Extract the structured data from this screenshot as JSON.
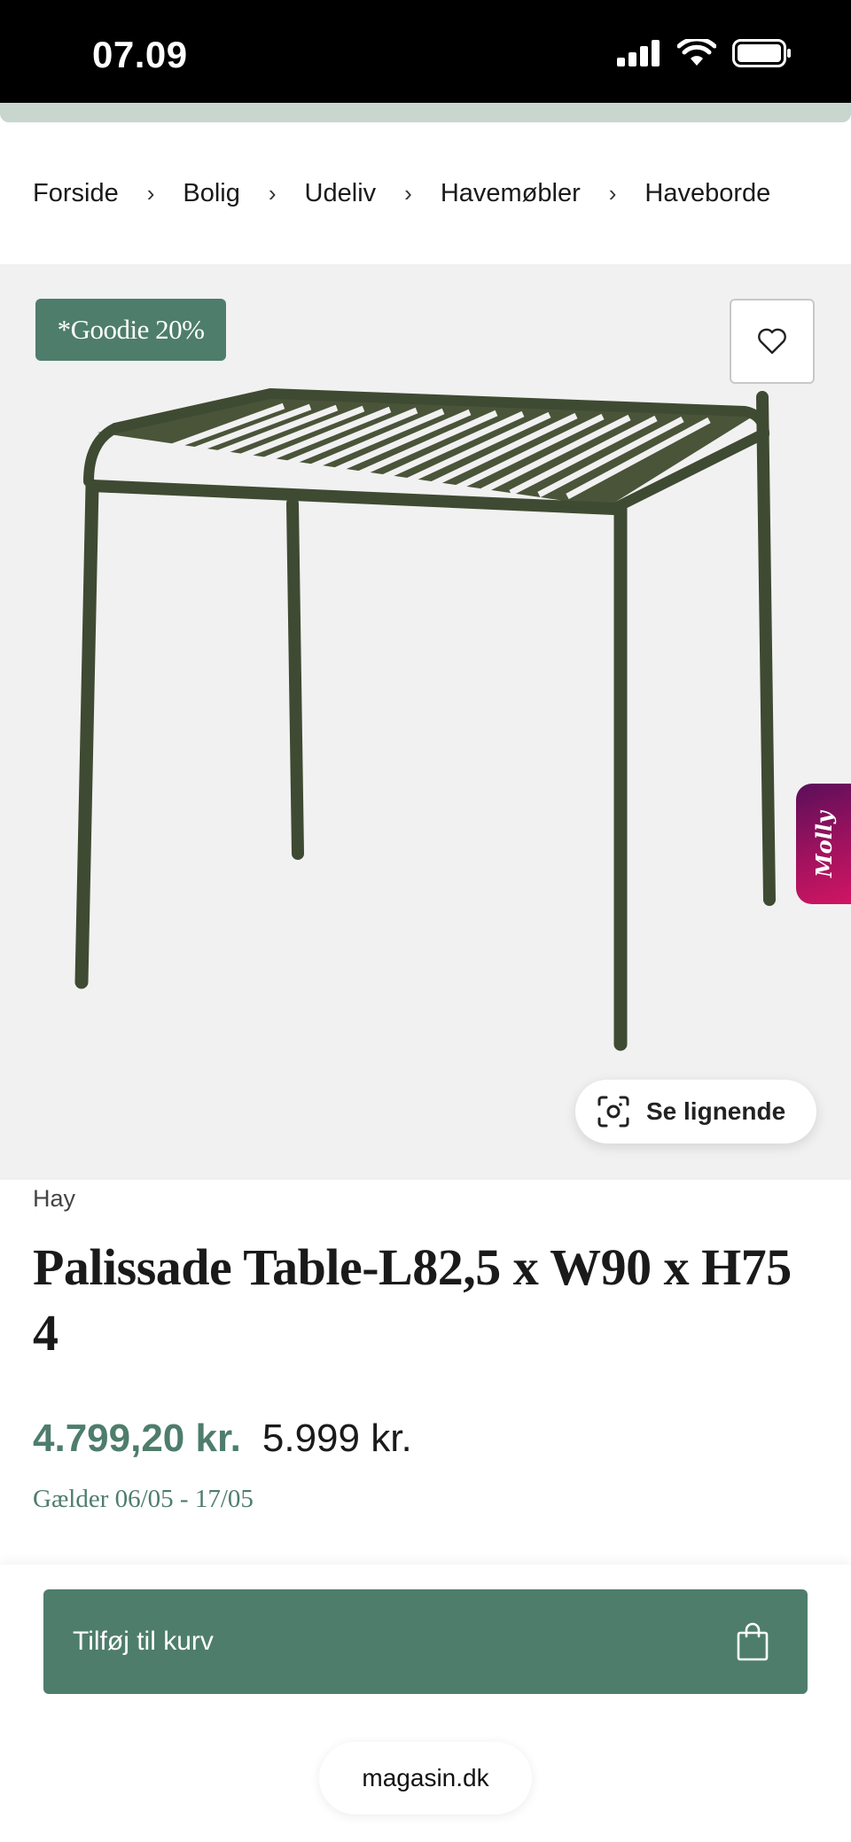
{
  "status_bar": {
    "time": "07.09",
    "icons": [
      "signal-icon",
      "wifi-icon",
      "battery-icon"
    ]
  },
  "breadcrumb": {
    "items": [
      "Forside",
      "Bolig",
      "Udeliv",
      "Havemøbler",
      "Haveborde"
    ],
    "separator": "›"
  },
  "product_image": {
    "badge": "*Goodie 20%",
    "favorite_icon": "heart-icon",
    "side_tab": "Molly",
    "similar_label": "Se lignende",
    "similar_icon": "visual-search-icon"
  },
  "product": {
    "brand": "Hay",
    "title_line1": "Palissade Table-L82,5 x W90 x H75",
    "title_line2": "4",
    "price_sale": "4.799,20 kr.",
    "price_original": "5.999 kr.",
    "validity": "Gælder 06/05 - 17/05"
  },
  "cart": {
    "add_label": "Tilføj til kurv",
    "icon": "shopping-bag-icon"
  },
  "browser": {
    "url": "magasin.dk"
  },
  "colors": {
    "accent": "#4e7d6c",
    "image_bg": "#f1f1f1",
    "strip": "#c9d6d0",
    "table_color": "#3f4a32",
    "molly_gradient_start": "#5a0e5a",
    "molly_gradient_end": "#d11563"
  }
}
